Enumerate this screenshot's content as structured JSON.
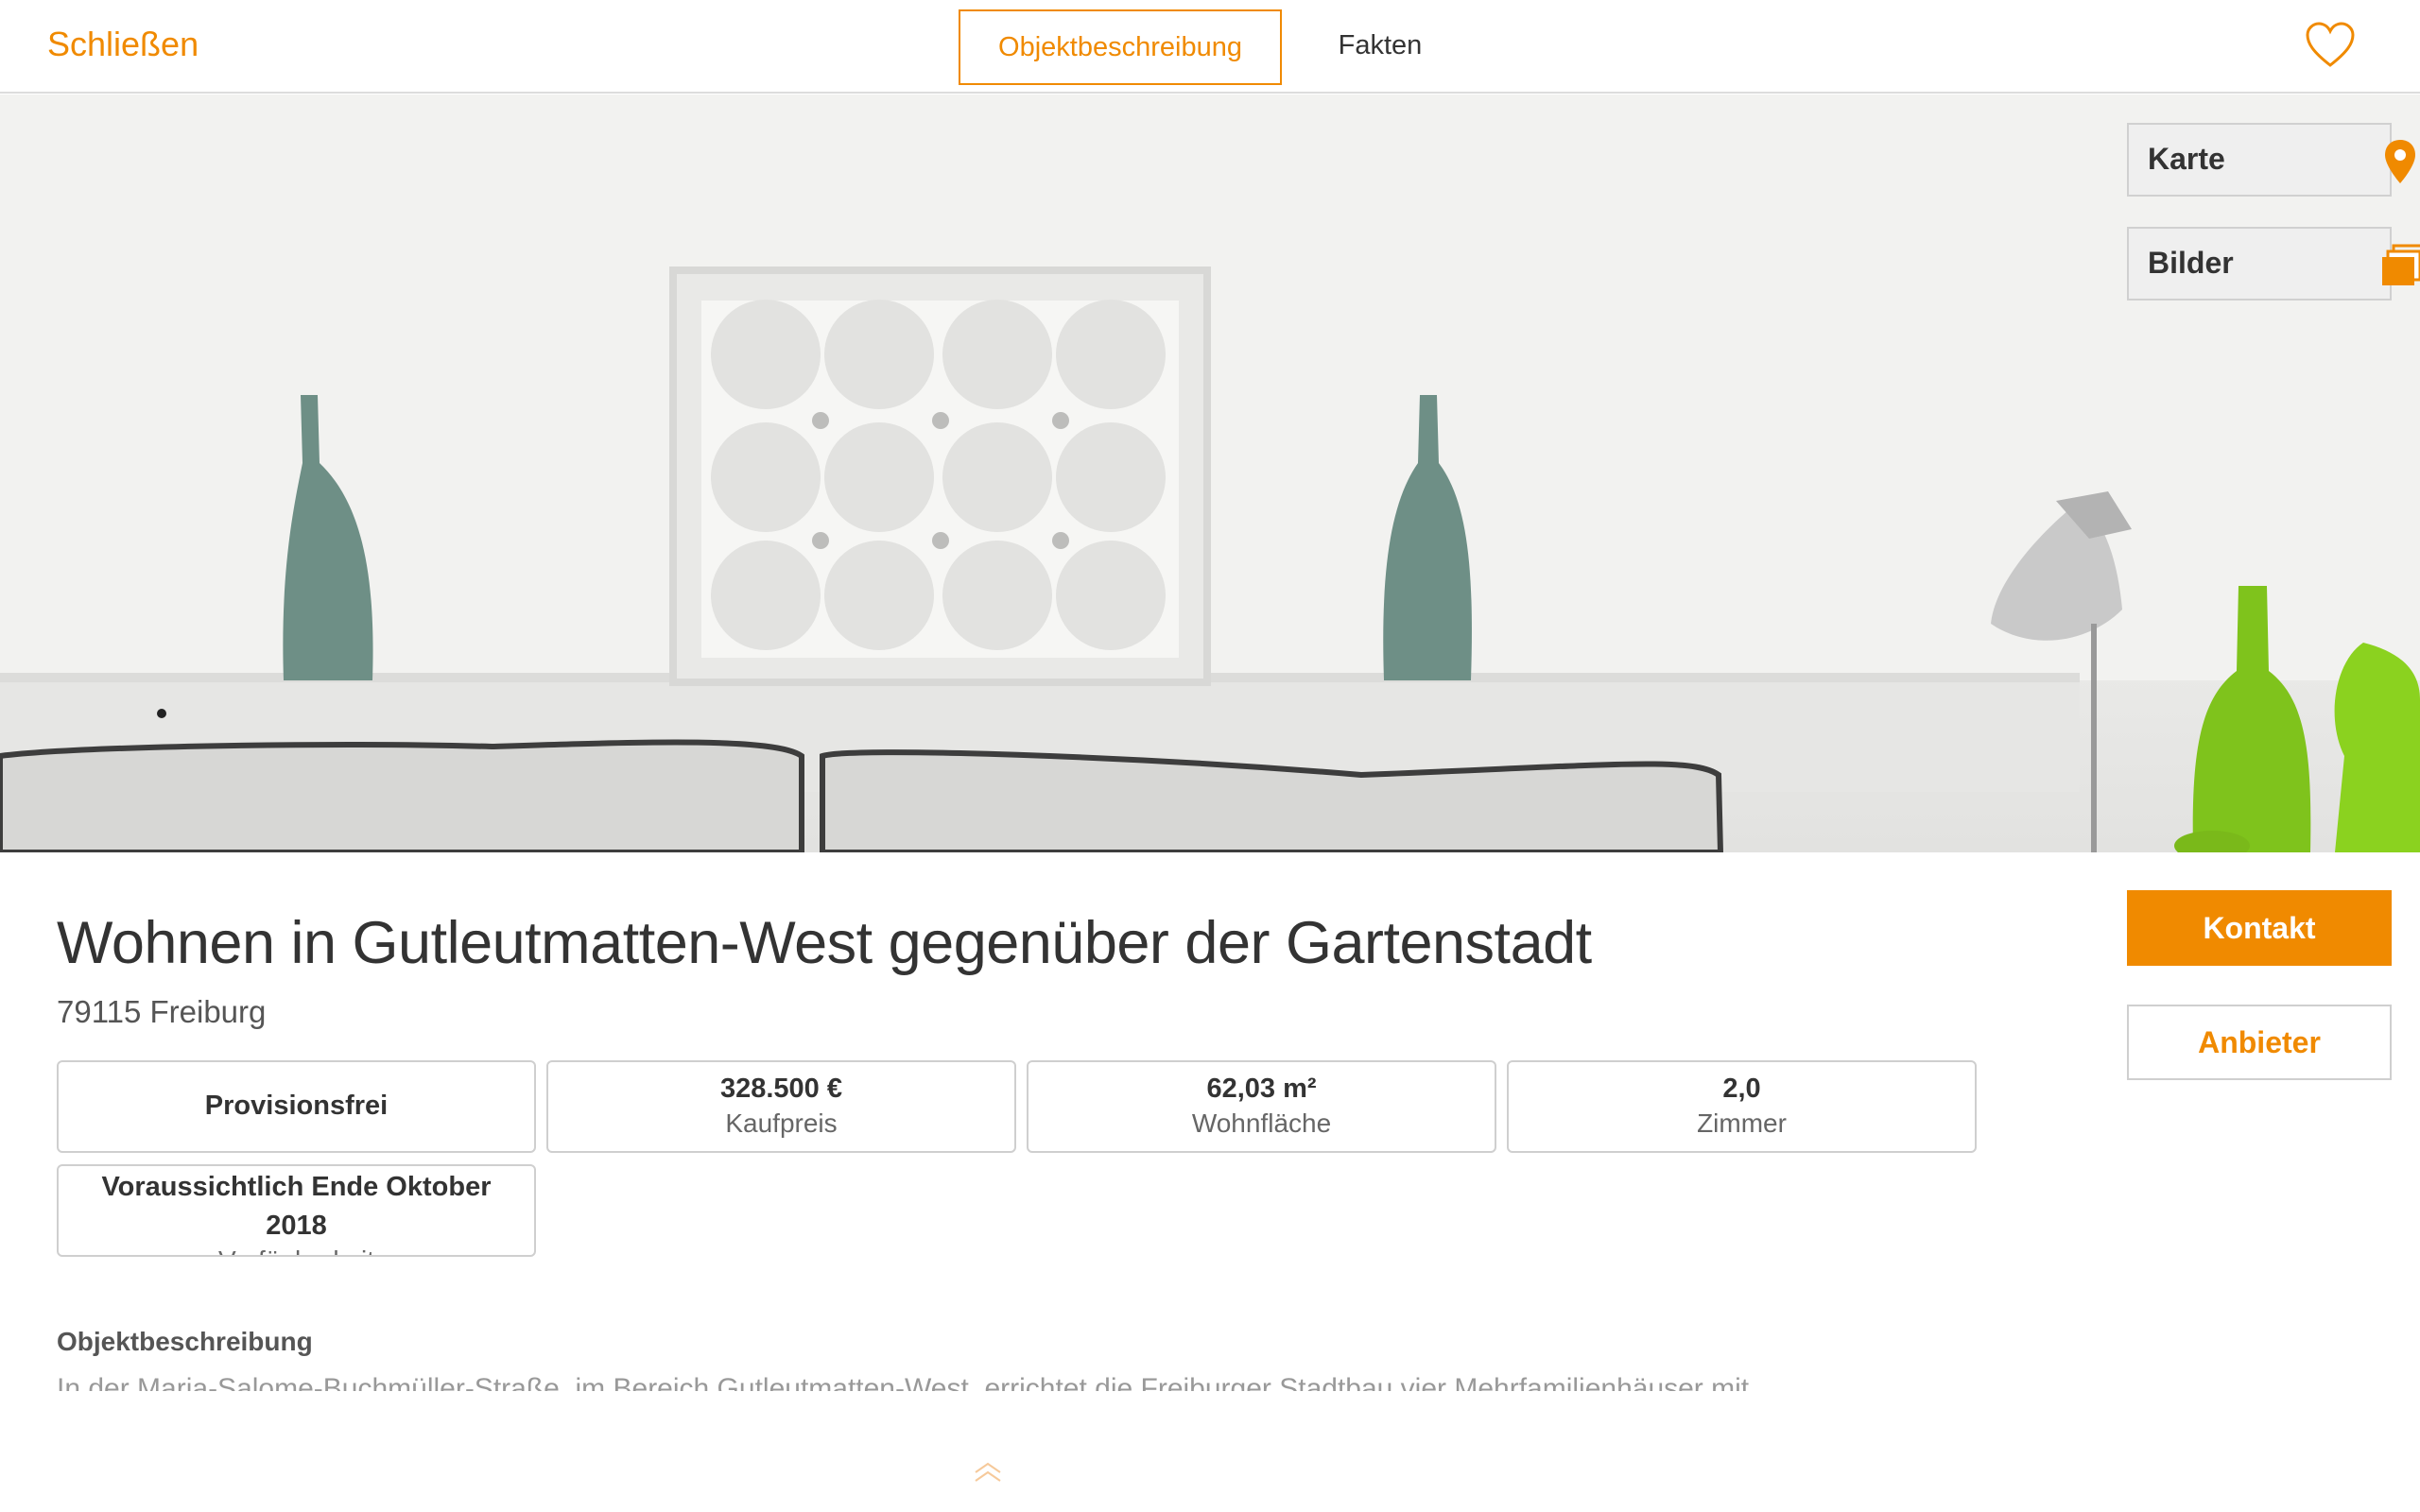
{
  "header": {
    "close_label": "Schließen",
    "tabs": [
      {
        "label": "Objektbeschreibung",
        "active": true
      },
      {
        "label": "Fakten",
        "active": false
      }
    ],
    "favorite_icon": "heart-outline-icon"
  },
  "hero": {
    "buttons": {
      "map_label": "Karte",
      "map_icon": "map-pin-icon",
      "images_label": "Bilder",
      "images_icon": "image-stack-icon"
    }
  },
  "listing": {
    "title": "Wohnen in Gutleutmatten-West gegenüber der Gartenstadt",
    "address": "79115 Freiburg",
    "facts": [
      {
        "value": "Provisionsfrei"
      },
      {
        "value": "328.500 €",
        "label": "Kaufpreis"
      },
      {
        "value": "62,03 m²",
        "label": "Wohnfläche"
      },
      {
        "value": "2,0",
        "label": "Zimmer"
      },
      {
        "value": "Voraussichtlich Ende Oktober 2018",
        "label": "Verfügbarkeit"
      }
    ]
  },
  "actions": {
    "contact_label": "Kontakt",
    "provider_label": "Anbieter"
  },
  "description": {
    "heading": "Objektbeschreibung",
    "text": "In der Maria-Salome-Buchmüller-Straße, im Bereich Gutleutmatten-West, errichtet die Freiburger Stadtbau vier Mehrfamilienhäuser mit"
  },
  "colors": {
    "accent": "#f08a00",
    "text": "#333333",
    "border": "#cfcfcf"
  }
}
